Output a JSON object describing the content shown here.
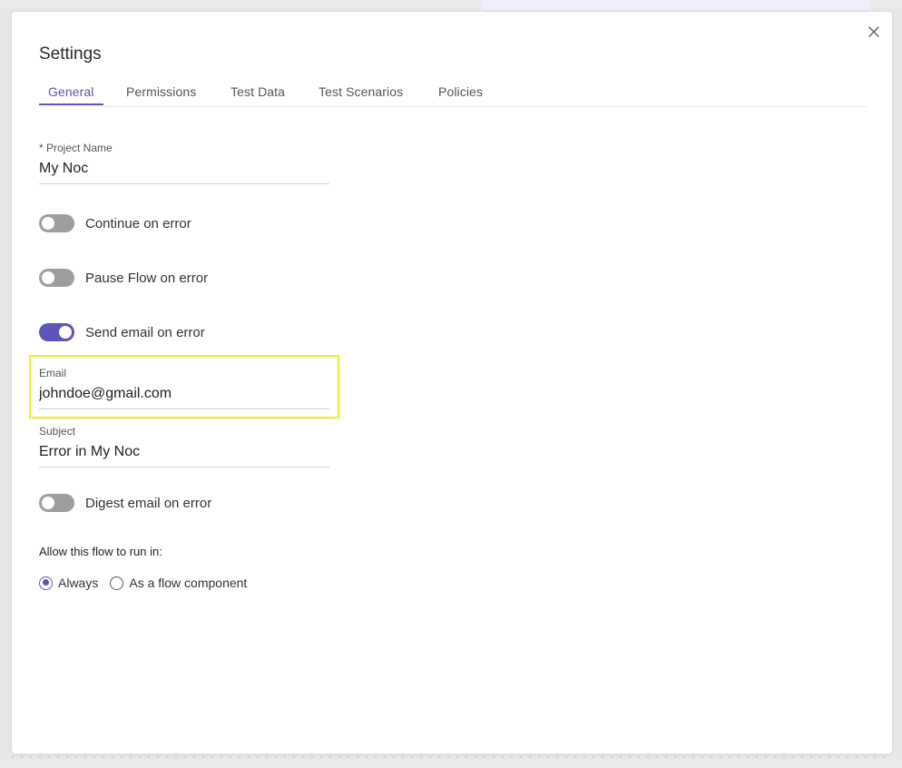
{
  "dialog": {
    "title": "Settings",
    "close_icon": "close-icon"
  },
  "tabs": [
    {
      "label": "General",
      "active": true
    },
    {
      "label": "Permissions",
      "active": false
    },
    {
      "label": "Test Data",
      "active": false
    },
    {
      "label": "Test Scenarios",
      "active": false
    },
    {
      "label": "Policies",
      "active": false
    }
  ],
  "project": {
    "label": "* Project Name",
    "value": "My Noc"
  },
  "toggles": {
    "continue_on_error": {
      "label": "Continue on error",
      "on": false
    },
    "pause_flow_on_error": {
      "label": "Pause Flow on error",
      "on": false
    },
    "send_email_on_error": {
      "label": "Send email on error",
      "on": true
    },
    "digest_email_on_error": {
      "label": "Digest email on error",
      "on": false
    }
  },
  "email": {
    "label": "Email",
    "value": "johndoe@gmail.com"
  },
  "subject": {
    "label": "Subject",
    "value": "Error in My Noc"
  },
  "run_in": {
    "label": "Allow this flow to run in:",
    "options": [
      {
        "label": "Always",
        "checked": true
      },
      {
        "label": "As a flow component",
        "checked": false
      }
    ]
  },
  "colors": {
    "accent": "#5b56b8",
    "highlight": "#f0ee1d",
    "toggle_off": "#9e9e9e"
  }
}
